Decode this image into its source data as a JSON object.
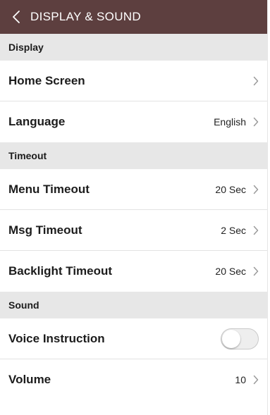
{
  "header": {
    "title": "DISPLAY & SOUND",
    "back_icon": "chevron-left-icon",
    "background_color": "#5d3f3f"
  },
  "sections": {
    "display": {
      "title": "Display",
      "home_screen": {
        "label": "Home Screen",
        "value": ""
      },
      "language": {
        "label": "Language",
        "value": "English"
      }
    },
    "timeout": {
      "title": "Timeout",
      "menu_timeout": {
        "label": "Menu Timeout",
        "value": "20 Sec"
      },
      "msg_timeout": {
        "label": "Msg Timeout",
        "value": "2 Sec"
      },
      "backlight_timeout": {
        "label": "Backlight Timeout",
        "value": "20 Sec"
      }
    },
    "sound": {
      "title": "Sound",
      "voice_instruction": {
        "label": "Voice Instruction",
        "enabled": false
      },
      "volume": {
        "label": "Volume",
        "value": "10"
      }
    }
  },
  "icons": {
    "row_chevron": "chevron-right-icon"
  }
}
